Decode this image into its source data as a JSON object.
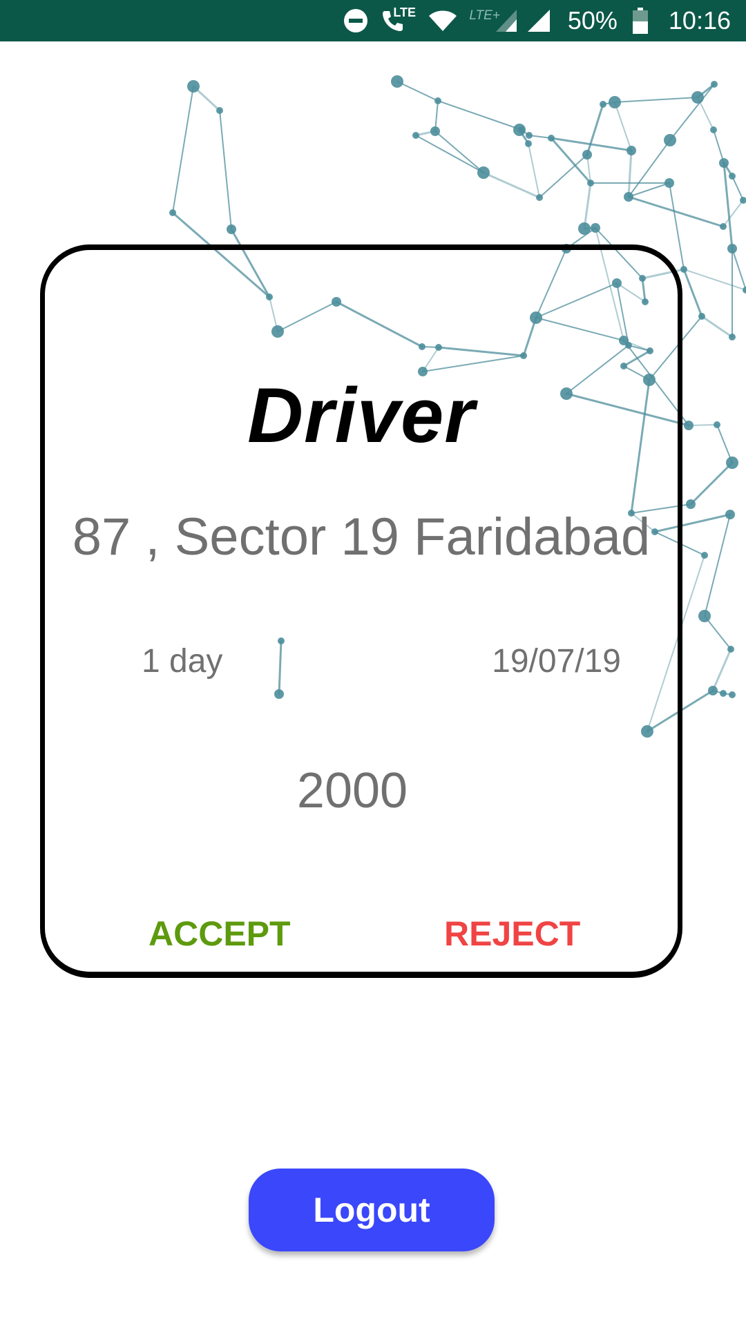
{
  "status_bar": {
    "icons": [
      "do-not-disturb-icon",
      "volte-call-icon",
      "wifi-icon",
      "signal-icon",
      "signal-icon",
      "battery-icon"
    ],
    "volte_label": "LTE",
    "lte_label": "LTE+",
    "battery": "50%",
    "time": "10:16"
  },
  "card": {
    "title": "Driver",
    "address": "87 , Sector 19 Faridabad",
    "duration": "1 day",
    "date": "19/07/19",
    "amount": "2000",
    "accept_label": "ACCEPT",
    "reject_label": "REJECT"
  },
  "logout_label": "Logout",
  "colors": {
    "status_bar": "#0b5848",
    "accept": "#5e9a0e",
    "reject": "#f04444",
    "logout_button": "#3a47fb",
    "network_lines": "#4d8e9b"
  }
}
